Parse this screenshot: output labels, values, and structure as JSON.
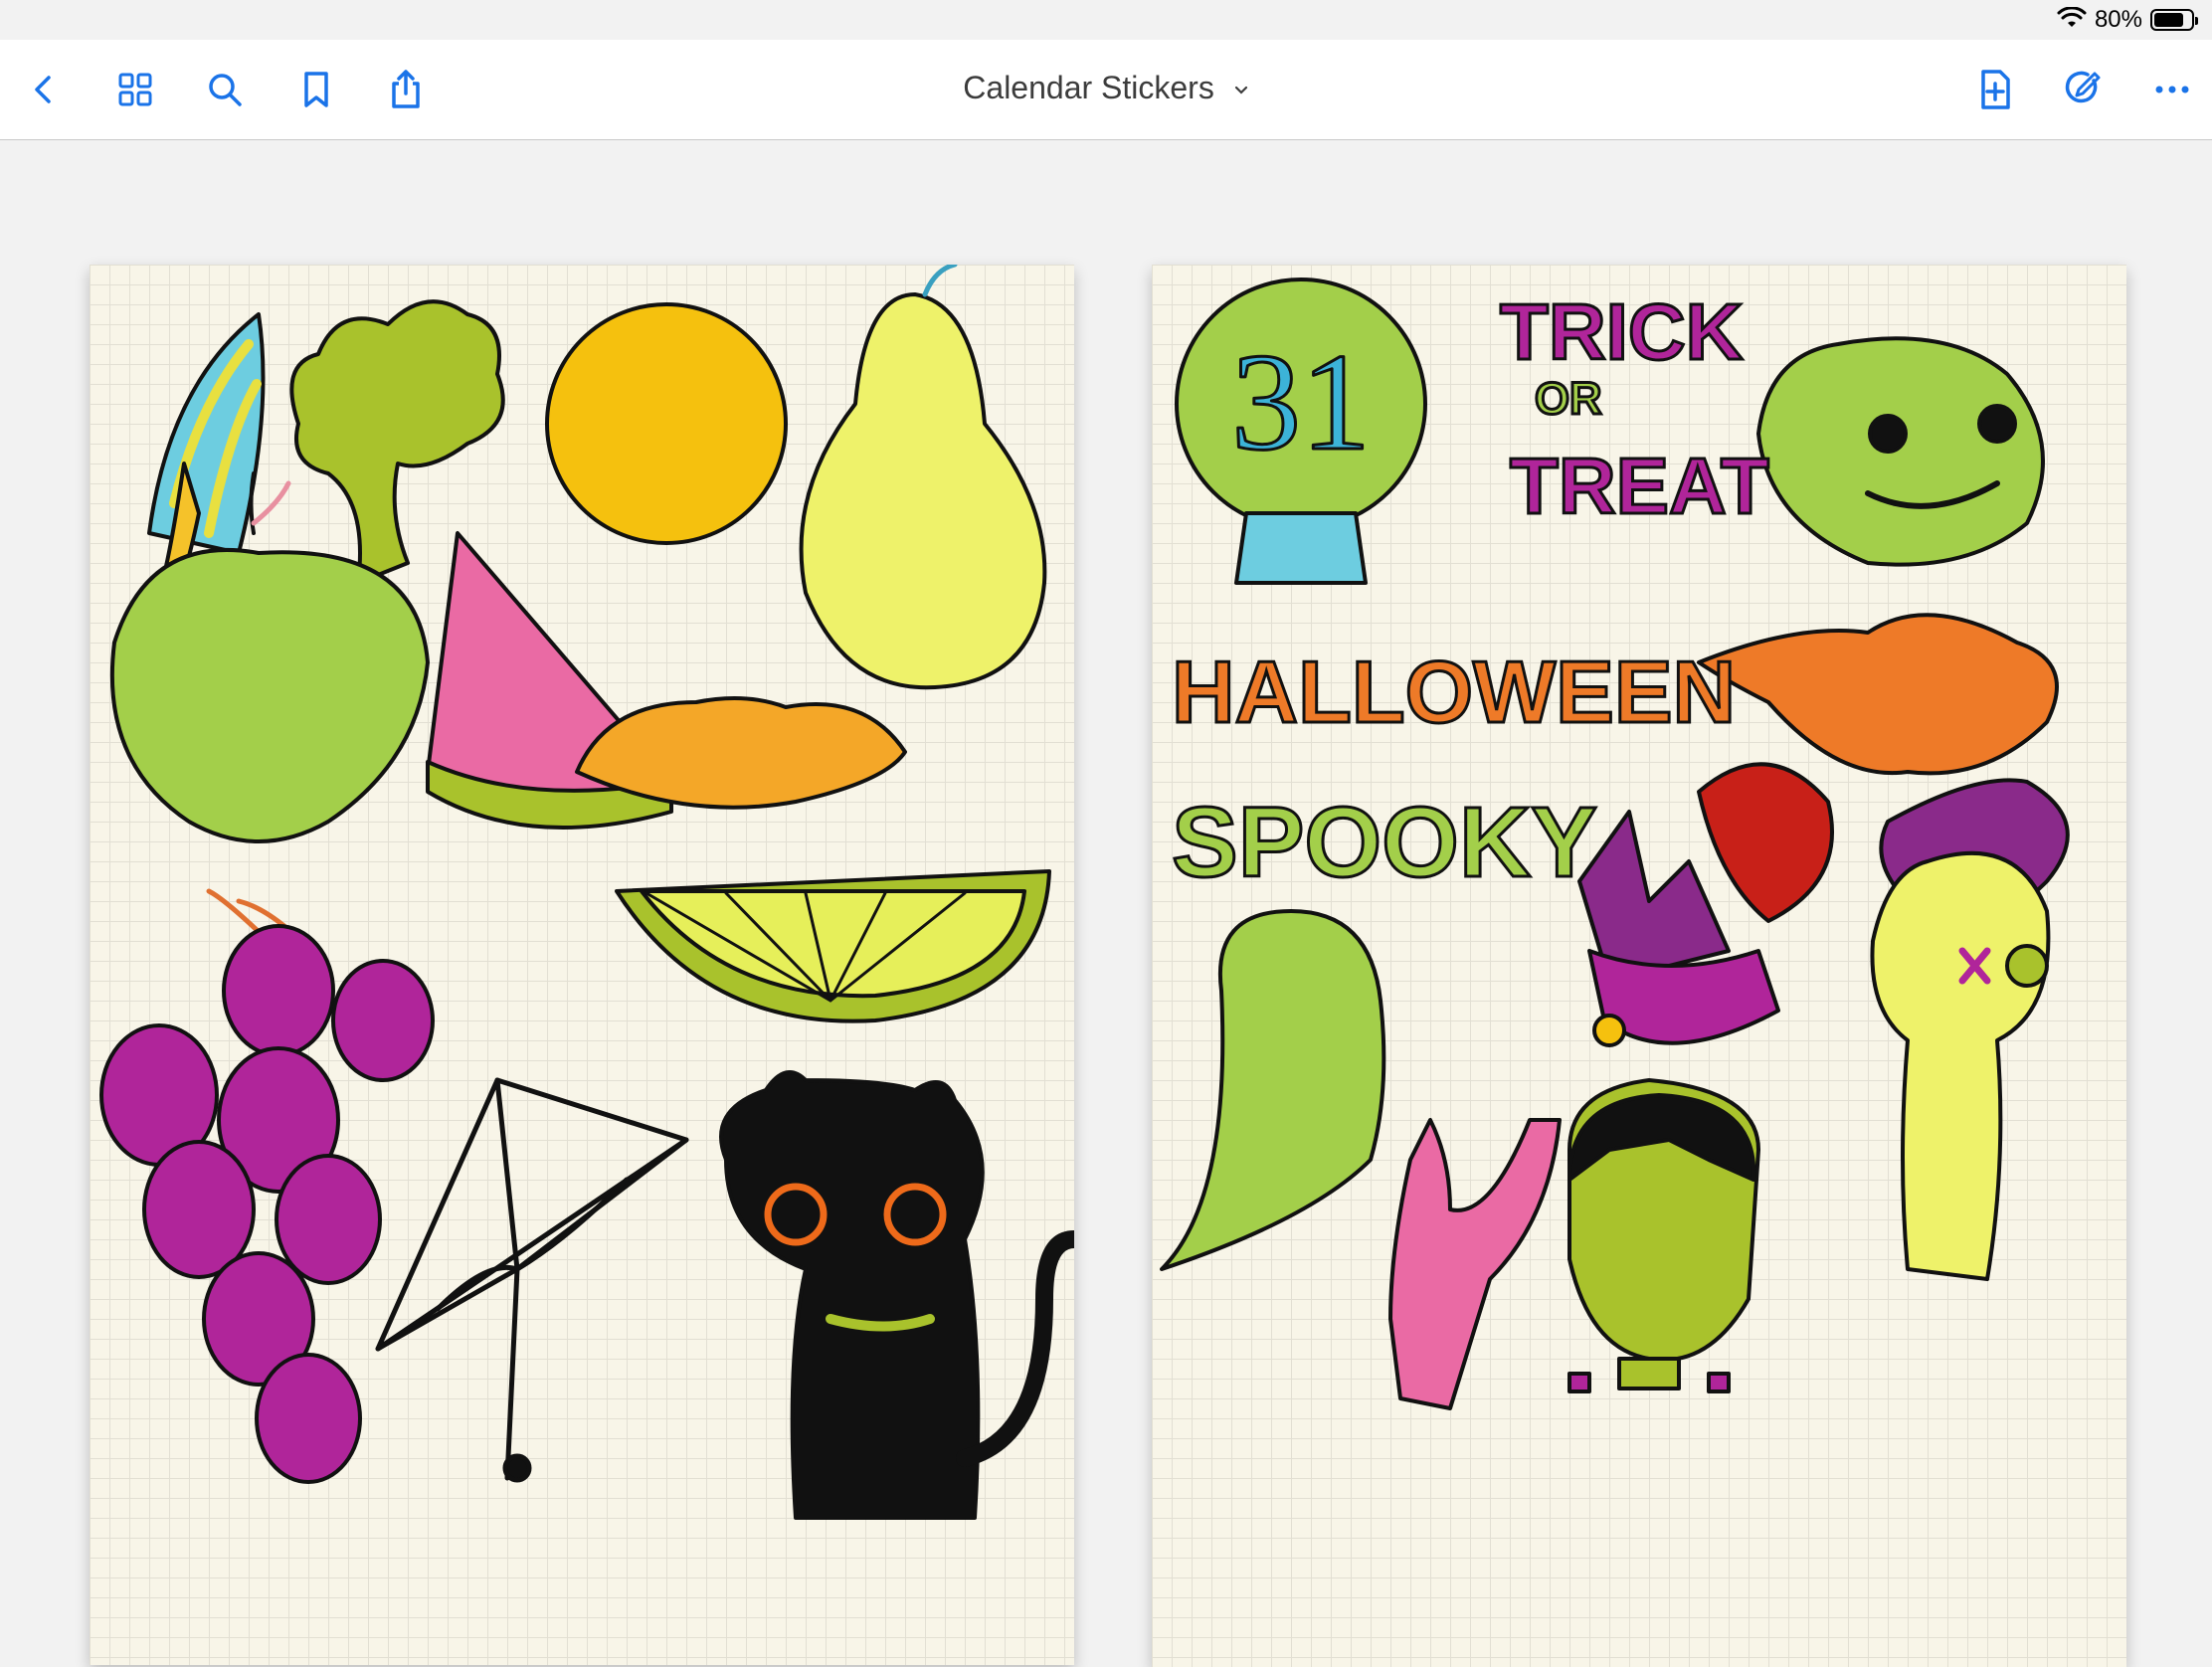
{
  "status_bar": {
    "battery_percent": "80%",
    "wifi_icon": "wifi-icon",
    "battery_level": 0.8
  },
  "toolbar": {
    "title": "Calendar Stickers",
    "left_icons": [
      "back-chevron-icon",
      "grid-icon",
      "search-icon",
      "bookmark-icon",
      "share-icon"
    ],
    "right_icons": [
      "add-page-icon",
      "markup-pen-icon",
      "more-icon"
    ],
    "accent_color": "#1a73e8"
  },
  "pages": [
    {
      "name": "fruit-sticker-page",
      "stickers": [
        "mushroom",
        "broccoli",
        "orange",
        "pear",
        "apple",
        "watermelon-slice",
        "lemon",
        "lime-slice",
        "grapes",
        "spider-web",
        "black-cat"
      ]
    },
    {
      "name": "halloween-sticker-page",
      "crystal_ball_number": "31",
      "trick_text": "TRICK",
      "or_text": "OR",
      "treat_text": "TREAT",
      "halloween_text": "HALLOWEEN",
      "spooky_text": "SPOOKY",
      "stickers": [
        "crystal-ball",
        "pumpkin",
        "oak-leaf",
        "red-leaf",
        "purple-leaf",
        "ghost",
        "crystals-in-cauldron",
        "zombie-hand",
        "voodoo-doll",
        "frankenstein"
      ]
    }
  ],
  "colors": {
    "page_background": "#f8f5e8",
    "canvas_background": "#f2f2f2",
    "grid_line": "#e2dfd3"
  }
}
